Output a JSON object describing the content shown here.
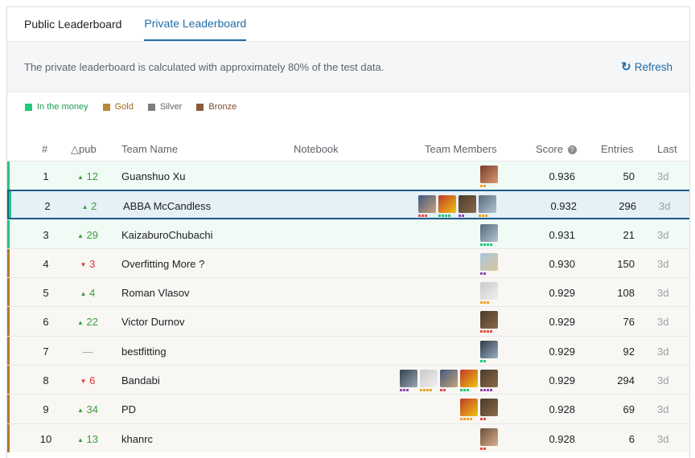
{
  "tabs": [
    {
      "label": "Public Leaderboard",
      "active": false
    },
    {
      "label": "Private Leaderboard",
      "active": true
    }
  ],
  "info": {
    "text": "The private leaderboard is calculated with approximately 80% of the test data.",
    "refresh_label": "Refresh"
  },
  "legend": [
    {
      "label": "In the money",
      "color": "#20BEFF",
      "text_color": "#1f9d55",
      "swatch": "#20c97a"
    },
    {
      "label": "Gold",
      "color": "#A4823B",
      "text_color": "#a06b12",
      "swatch": "#b8893b"
    },
    {
      "label": "Silver",
      "color": "#7E7E7E",
      "text_color": "#5f6368",
      "swatch": "#7e7e7e"
    },
    {
      "label": "Bronze",
      "color": "#8B5A3C",
      "text_color": "#7a4a2e",
      "swatch": "#8b5a3c"
    }
  ],
  "columns": {
    "rank": "#",
    "delta": "△pub",
    "team": "Team Name",
    "notebook": "Notebook",
    "members": "Team Members",
    "score": "Score",
    "entries": "Entries",
    "last": "Last"
  },
  "rows": [
    {
      "rank": "1",
      "delta": "12",
      "dir": "up",
      "team": "Guanshuo Xu",
      "score": "0.936",
      "entries": "50",
      "last": "3d",
      "tier": "money",
      "avatars": 1
    },
    {
      "rank": "2",
      "delta": "2",
      "dir": "up",
      "team": "ABBA McCandless",
      "score": "0.932",
      "entries": "296",
      "last": "3d",
      "tier": "money",
      "avatars": 4,
      "highlight": true
    },
    {
      "rank": "3",
      "delta": "29",
      "dir": "up",
      "team": "KaizaburoChubachi",
      "score": "0.931",
      "entries": "21",
      "last": "3d",
      "tier": "money",
      "avatars": 1
    },
    {
      "rank": "4",
      "delta": "3",
      "dir": "down",
      "team": "Overfitting More ?",
      "score": "0.930",
      "entries": "150",
      "last": "3d",
      "tier": "gold",
      "avatars": 1
    },
    {
      "rank": "5",
      "delta": "4",
      "dir": "up",
      "team": "Roman Vlasov",
      "score": "0.929",
      "entries": "108",
      "last": "3d",
      "tier": "gold",
      "avatars": 1
    },
    {
      "rank": "6",
      "delta": "22",
      "dir": "up",
      "team": "Victor Durnov",
      "score": "0.929",
      "entries": "76",
      "last": "3d",
      "tier": "gold",
      "avatars": 1
    },
    {
      "rank": "7",
      "delta": "—",
      "dir": "same",
      "team": "bestfitting",
      "score": "0.929",
      "entries": "92",
      "last": "3d",
      "tier": "gold",
      "avatars": 1
    },
    {
      "rank": "8",
      "delta": "6",
      "dir": "down",
      "team": "Bandabi",
      "score": "0.929",
      "entries": "294",
      "last": "3d",
      "tier": "gold",
      "avatars": 5
    },
    {
      "rank": "9",
      "delta": "34",
      "dir": "up",
      "team": "PD",
      "score": "0.928",
      "entries": "69",
      "last": "3d",
      "tier": "gold",
      "avatars": 2
    },
    {
      "rank": "10",
      "delta": "13",
      "dir": "up",
      "team": "khanrc",
      "score": "0.928",
      "entries": "6",
      "last": "3d",
      "tier": "gold",
      "avatars": 1
    }
  ],
  "colors": {
    "accent": "#1f6ca6",
    "money_bar": "#20c97a",
    "money_bg": "#f0fbf5",
    "gold_bar": "#b07b2a",
    "gold_bg": "#f8f7f4",
    "highlight_bg": "#e6f0f7"
  }
}
